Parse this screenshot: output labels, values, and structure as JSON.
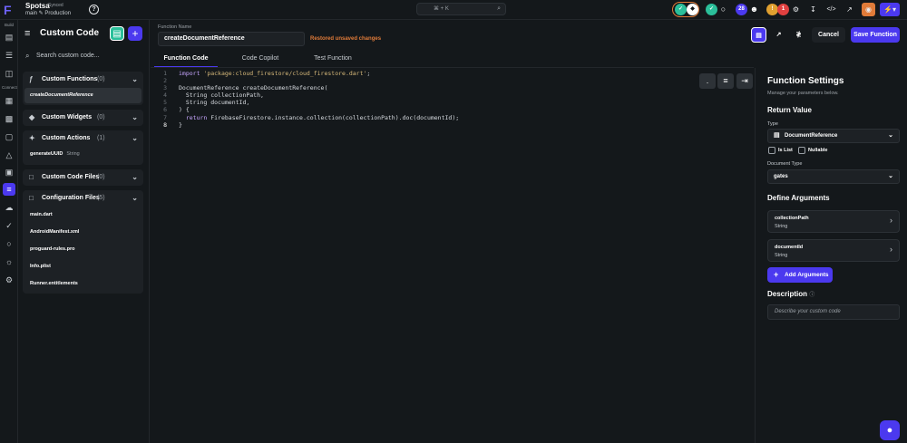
{
  "app": {
    "project_name": "Spotsa",
    "project_sub": "Synced",
    "branch": "main ✎ Production",
    "search_shortcut": "⌘ + K"
  },
  "header": {
    "badge_count": "28",
    "notif_count": "1",
    "cancel_label": "Cancel",
    "save_label": "Save Function"
  },
  "rail": {
    "build_label": "Build",
    "connect_label": "Connect"
  },
  "left_panel": {
    "title": "Custom Code",
    "search_placeholder": "Search custom code...",
    "sections": [
      {
        "label": "Custom Functions",
        "count": "(0)",
        "items": [
          {
            "name": "createDocumentReference"
          }
        ]
      },
      {
        "label": "Custom Widgets",
        "count": "(0)"
      },
      {
        "label": "Custom Actions",
        "count": "(1)",
        "items": [
          {
            "name": "generateUUID",
            "type": "String"
          }
        ]
      },
      {
        "label": "Custom Code Files",
        "count": "(0)"
      },
      {
        "label": "Configuration Files",
        "count": "(5)",
        "items": [
          {
            "name": "main.dart"
          },
          {
            "name": "AndroidManifest.xml"
          },
          {
            "name": "proguard-rules.pro"
          },
          {
            "name": "Info.plist"
          },
          {
            "name": "Runner.entitlements"
          }
        ]
      }
    ]
  },
  "editor": {
    "function_name_label": "Function Name",
    "function_name": "createDocumentReference",
    "status": "Restored unsaved changes",
    "tabs": [
      "Function Code",
      "Code Copilot",
      "Test Function"
    ],
    "code": {
      "l1_kw": "import",
      "l1_str": "'package:cloud_firestore/cloud_firestore.dart'",
      "l1_end": ";",
      "l3": "DocumentReference createDocumentReference(",
      "l4": "  String collectionPath,",
      "l5": "  String documentId,",
      "l6": ") {",
      "l7_kw": "return",
      "l7": " FirebaseFirestore.instance.collection(collectionPath).doc(documentId);",
      "l8": "}"
    }
  },
  "settings": {
    "title": "Function Settings",
    "subtitle": "Manage your parameters below.",
    "return_value": "Return Value",
    "type_label": "Type",
    "type_value": "DocumentReference",
    "is_list": "Is List",
    "nullable": "Nullable",
    "doc_type_label": "Document Type",
    "doc_type_value": "gates",
    "define_args": "Define Arguments",
    "args": [
      {
        "name": "collectionPath",
        "type": "String"
      },
      {
        "name": "documentId",
        "type": "String"
      }
    ],
    "add_args": "Add Arguments",
    "description_label": "Description",
    "description_placeholder": "Describe your custom code"
  }
}
